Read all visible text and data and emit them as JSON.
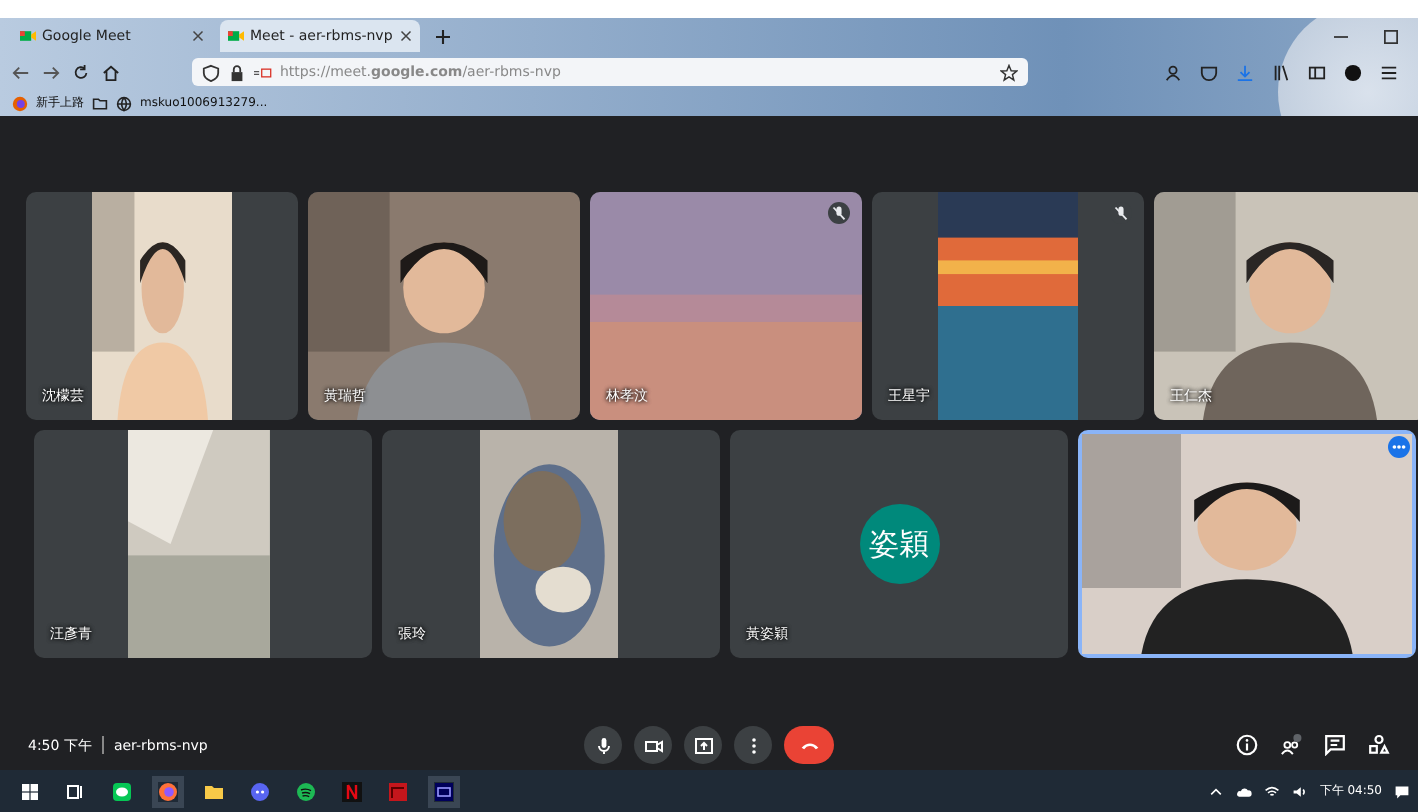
{
  "browser": {
    "tabs": [
      {
        "title": "Google Meet",
        "selected": false
      },
      {
        "title": "Meet - aer-rbms-nvp",
        "selected": true
      }
    ],
    "address": "https://meet.**google.com**/aer-rbms-nvp",
    "bookmarks": [
      {
        "label": "新手上路"
      },
      {
        "label": "mskuo1006913279..."
      }
    ]
  },
  "tiles": [
    {
      "name": "沈檬芸",
      "kind": "video",
      "muted": false,
      "selected": false
    },
    {
      "name": "黃瑞哲",
      "kind": "video",
      "muted": false,
      "selected": false
    },
    {
      "name": "林孝汶",
      "kind": "video",
      "muted": true,
      "selected": false
    },
    {
      "name": "王星宇",
      "kind": "video",
      "muted": true,
      "selected": false
    },
    {
      "name": "王仁杰",
      "kind": "video",
      "muted": false,
      "selected": false
    },
    {
      "name": "汪彥青",
      "kind": "video",
      "muted": false,
      "selected": false
    },
    {
      "name": "張玲",
      "kind": "video",
      "muted": false,
      "selected": false
    },
    {
      "name": "黃姿穎",
      "kind": "avatar",
      "avatar_text": "姿穎",
      "muted": false,
      "selected": false
    },
    {
      "kind": "video",
      "muted": false,
      "selected": true
    }
  ],
  "meeting": {
    "time": "4:50 下午",
    "code": "aer-rbms-nvp"
  },
  "taskbar": {
    "clock": "下午 04:50"
  }
}
